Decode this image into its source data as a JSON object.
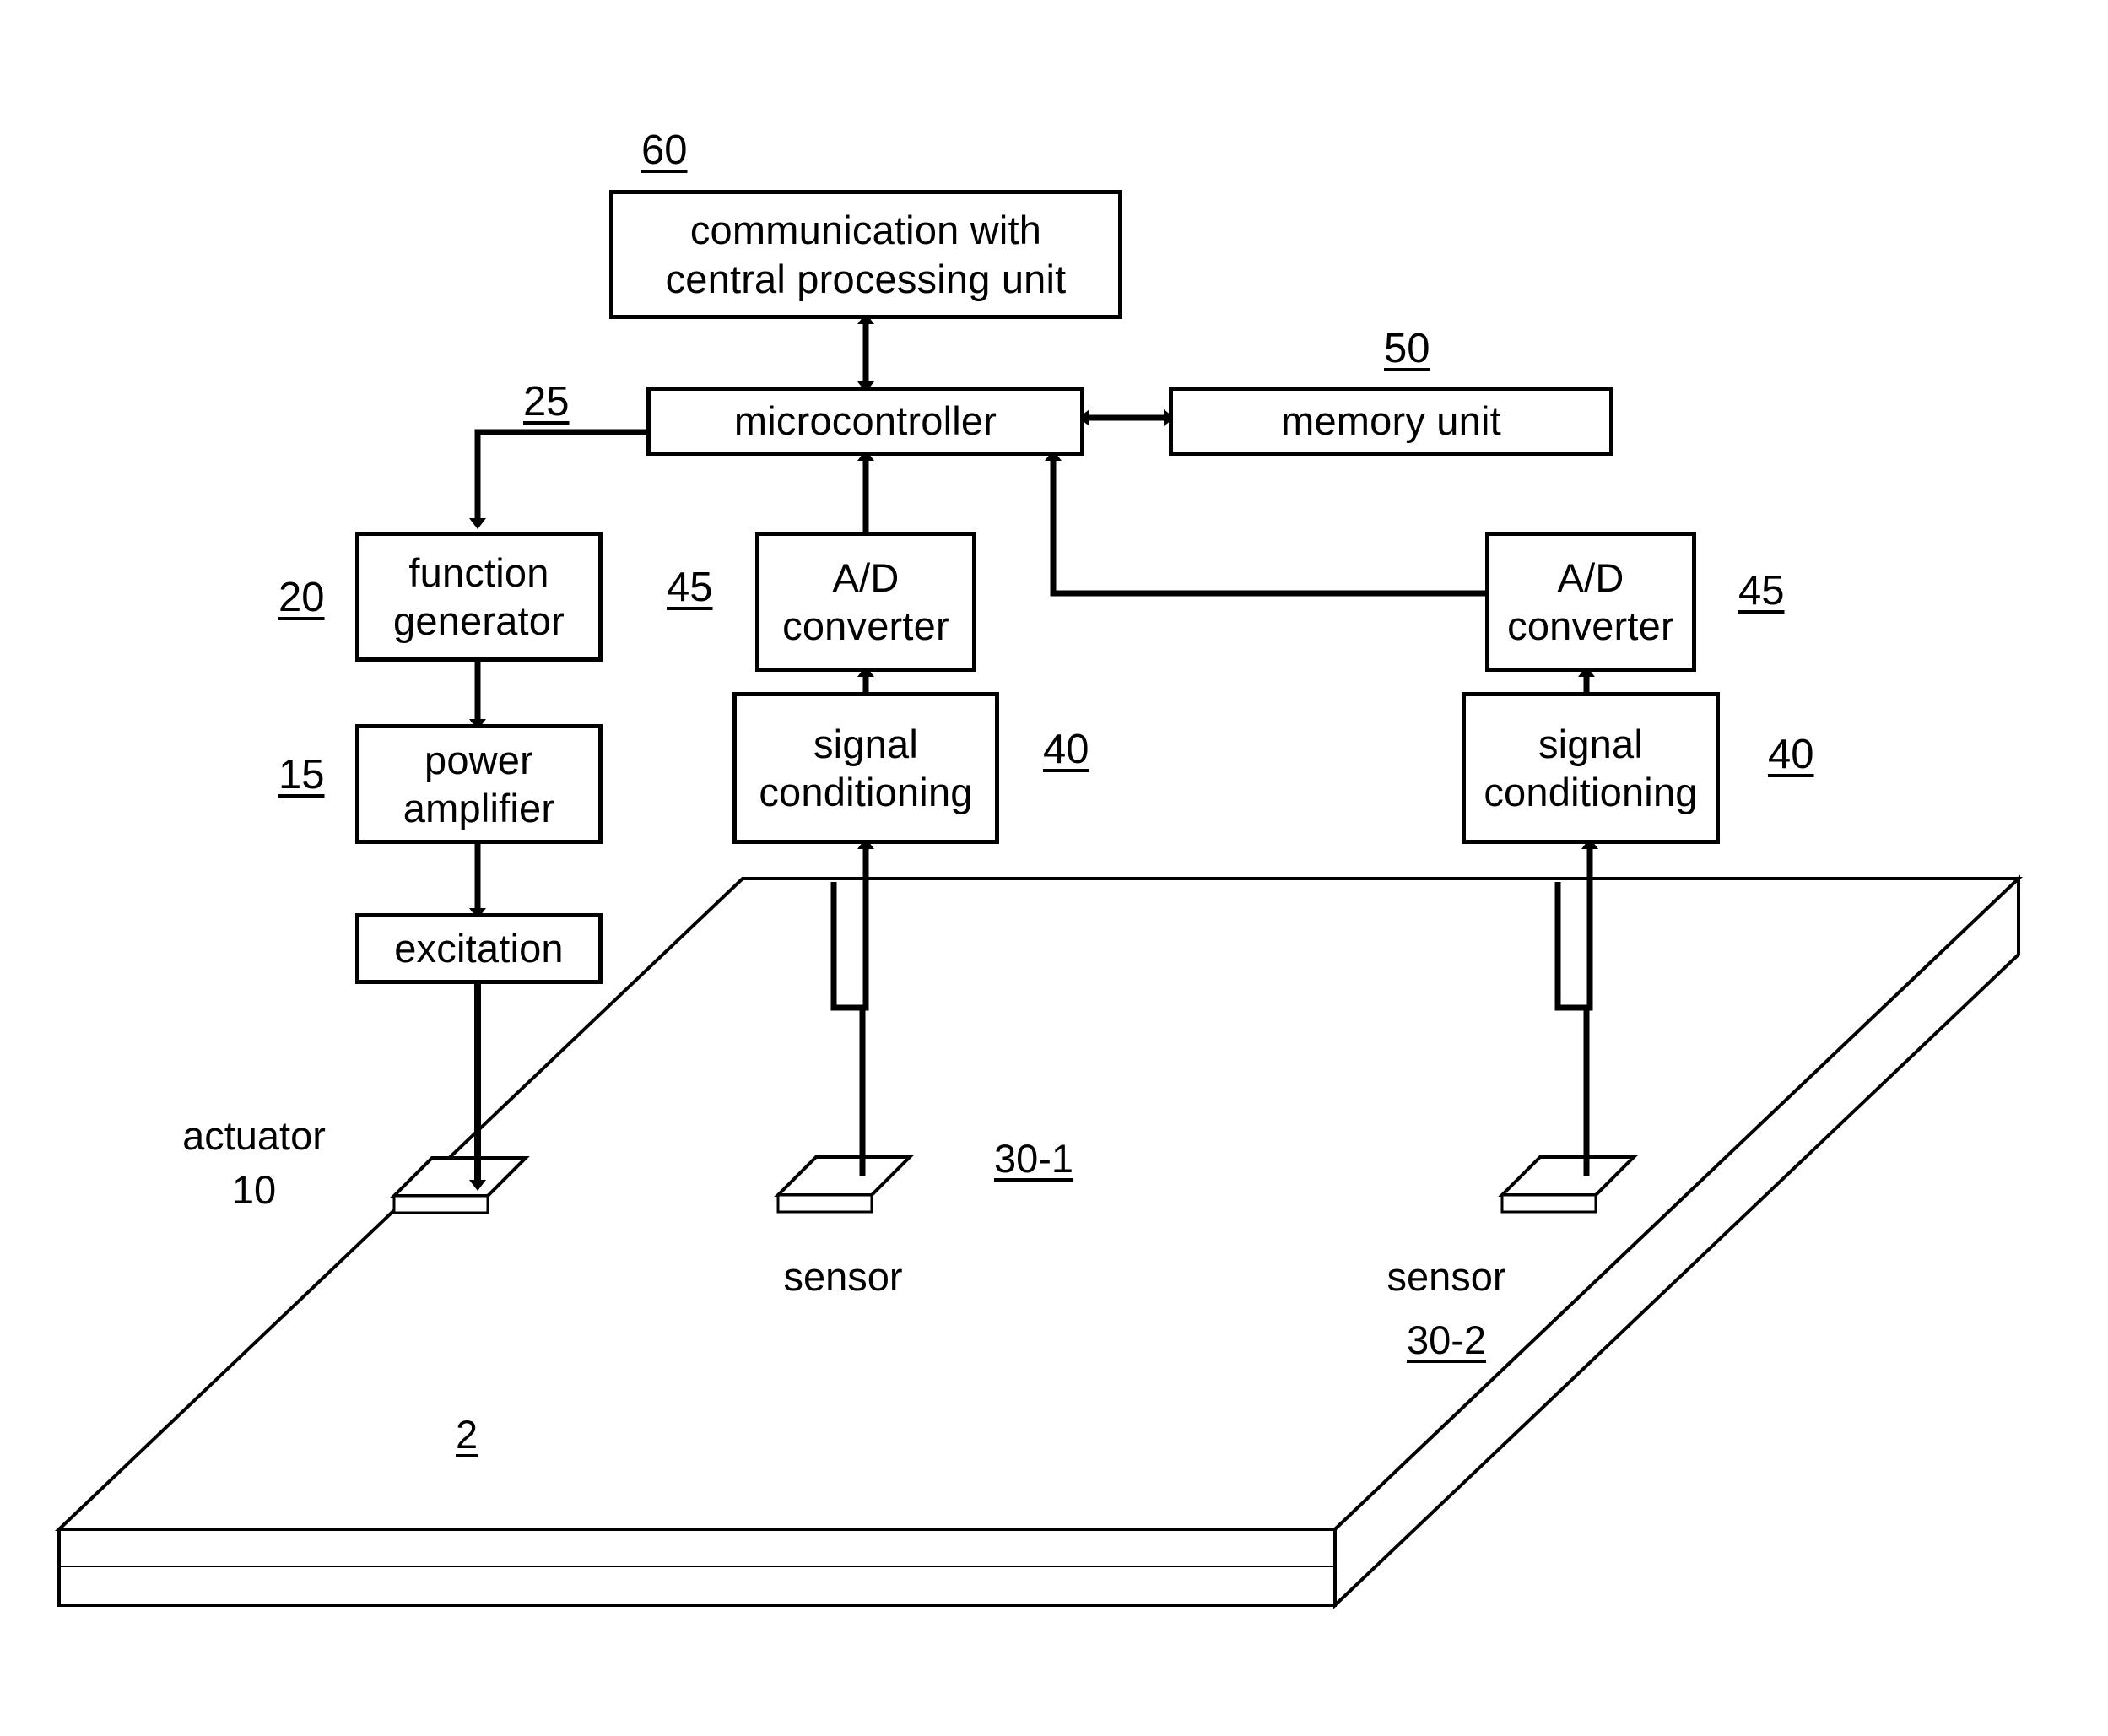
{
  "figure": {
    "title": "",
    "type": "block-diagram",
    "background": "#ffffff",
    "line_color": "#000000"
  },
  "blocks": {
    "communication": {
      "label": "communication with\ncentral processing unit",
      "ref": "60"
    },
    "microcontroller": {
      "label": "microcontroller",
      "ref": "25"
    },
    "memory": {
      "label": "memory unit",
      "ref": "50"
    },
    "function_generator": {
      "label": "function\ngenerator",
      "ref": "20"
    },
    "power_amplifier": {
      "label": "power\namplifier",
      "ref": "15"
    },
    "excitation": {
      "label": "excitation",
      "ref": ""
    },
    "ad_converter_left": {
      "label": "A/D\nconverter",
      "ref": "45"
    },
    "signal_conditioning_left": {
      "label": "signal\nconditioning",
      "ref": "40"
    },
    "ad_converter_right": {
      "label": "A/D\nconverter",
      "ref": "45"
    },
    "signal_conditioning_right": {
      "label": "signal\nconditioning",
      "ref": "40"
    }
  },
  "structure": {
    "plate_ref": "2",
    "actuator": {
      "name": "actuator",
      "ref": "10"
    },
    "sensor_1": {
      "name": "sensor",
      "ref": "30-1"
    },
    "sensor_2": {
      "name": "sensor",
      "ref": "30-2"
    }
  }
}
